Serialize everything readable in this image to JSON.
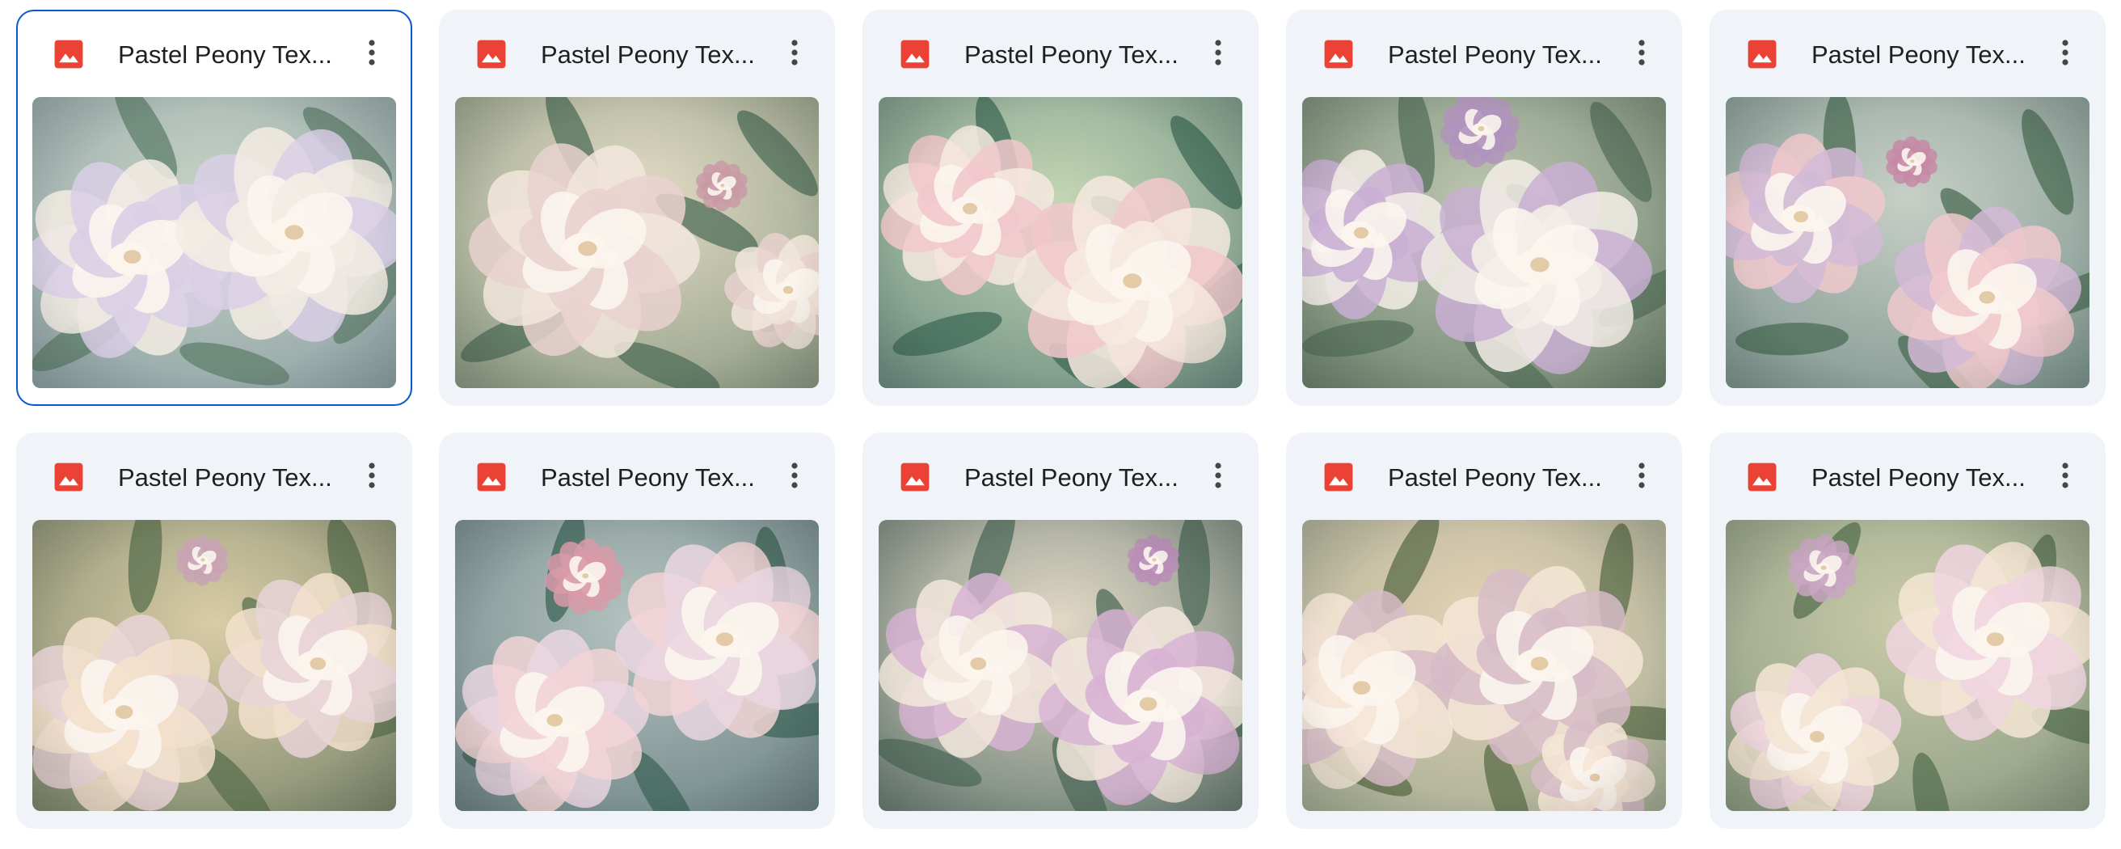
{
  "colors": {
    "card_bg": "#f0f4f9",
    "selected_border": "#0b57d0",
    "image_icon": "#ea4335",
    "title_text": "#1f1f1f"
  },
  "files": [
    {
      "title": "Pastel Peony Tex...",
      "icon": "image-file-icon",
      "selected": true,
      "palette": {
        "bg": "#c9d3c6",
        "bg2": "#8ea3a6",
        "f1": "#d9cfe6",
        "f2": "#f3ece4",
        "f3": "#cdb5cf",
        "leaf": "#5f7f6c"
      }
    },
    {
      "title": "Pastel Peony Tex...",
      "icon": "image-file-icon",
      "selected": false,
      "palette": {
        "bg": "#e4dcc6",
        "bg2": "#8d9b84",
        "f1": "#e9d1cf",
        "f2": "#f2e6dc",
        "f3": "#c99aa6",
        "leaf": "#4f6d58"
      }
    },
    {
      "title": "Pastel Peony Tex...",
      "icon": "image-file-icon",
      "selected": false,
      "palette": {
        "bg": "#c4d6b3",
        "bg2": "#6e8f84",
        "f1": "#f1c8cc",
        "f2": "#f6e9df",
        "f3": "#e3b8c0",
        "leaf": "#3f6a57"
      }
    },
    {
      "title": "Pastel Peony Tex...",
      "icon": "image-file-icon",
      "selected": false,
      "palette": {
        "bg": "#bdc5b0",
        "bg2": "#6f8570",
        "f1": "#c9afd4",
        "f2": "#f3ede7",
        "f3": "#b193bd",
        "leaf": "#55705b"
      }
    },
    {
      "title": "Pastel Peony Tex...",
      "icon": "image-file-icon",
      "selected": false,
      "palette": {
        "bg": "#c7cfc6",
        "bg2": "#7f9690",
        "f1": "#d2bad6",
        "f2": "#f0c9cd",
        "f3": "#c68aa6",
        "leaf": "#4b6c55"
      }
    },
    {
      "title": "Pastel Peony Tex...",
      "icon": "image-file-icon",
      "selected": false,
      "palette": {
        "bg": "#d9cca6",
        "bg2": "#7f8a6f",
        "f1": "#f3e0cc",
        "f2": "#e8d3d7",
        "f3": "#c8a3b4",
        "leaf": "#5a6f4d"
      }
    },
    {
      "title": "Pastel Peony Tex...",
      "icon": "image-file-icon",
      "selected": false,
      "palette": {
        "bg": "#b5c3bf",
        "bg2": "#6e8587",
        "f1": "#f2d3d6",
        "f2": "#ead6e0",
        "f3": "#d89aa9",
        "leaf": "#3e6457"
      }
    },
    {
      "title": "Pastel Peony Tex...",
      "icon": "image-file-icon",
      "selected": false,
      "palette": {
        "bg": "#e2d8c5",
        "bg2": "#6c7f77",
        "f1": "#f2e8dc",
        "f2": "#d7b3d3",
        "f3": "#b98db8",
        "leaf": "#4d6a5a"
      }
    },
    {
      "title": "Pastel Peony Tex...",
      "icon": "image-file-icon",
      "selected": false,
      "palette": {
        "bg": "#e6d2b5",
        "bg2": "#a5ae95",
        "f1": "#f5e6d6",
        "f2": "#d7bcc8",
        "f3": "#a98098",
        "leaf": "#5b6c48"
      }
    },
    {
      "title": "Pastel Peony Tex...",
      "icon": "image-file-icon",
      "selected": false,
      "palette": {
        "bg": "#c9cba9",
        "bg2": "#8d9c83",
        "f1": "#f4e6d4",
        "f2": "#f0d5e0",
        "f3": "#c9a6c2",
        "leaf": "#56704f"
      }
    }
  ]
}
